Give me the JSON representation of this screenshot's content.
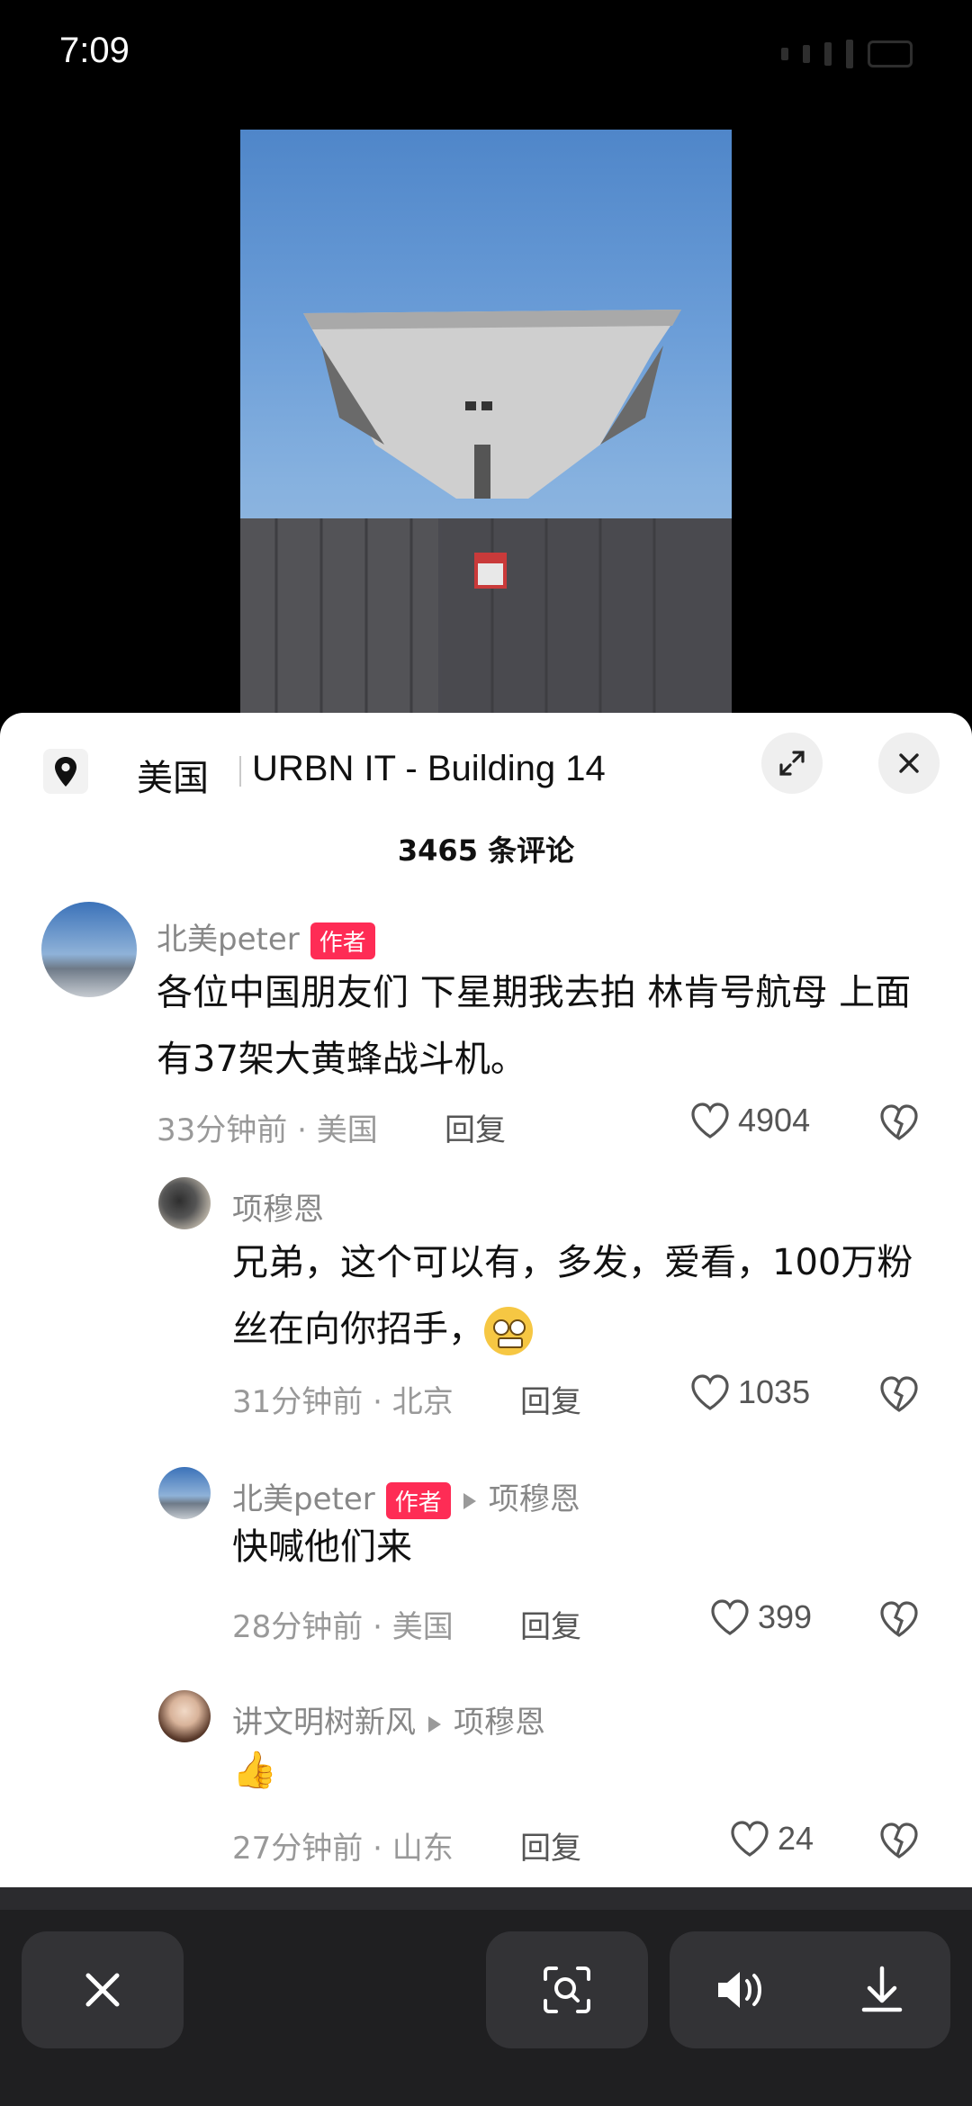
{
  "status_bar": {
    "time": "7:09"
  },
  "location": {
    "country": "美国",
    "place": "URBN IT - Building 14"
  },
  "comments_header": {
    "count_label": "3465 条评论"
  },
  "comments": [
    {
      "user": "北美peter",
      "badge": "作者",
      "text": "各位中国朋友们 下星期我去拍 林肯号航母 上面有37架大黄蜂战斗机。",
      "time": "33分钟前",
      "region": "美国",
      "reply_label": "回复",
      "likes": "4904"
    },
    {
      "user": "项穆恩",
      "text": "兄弟，这个可以有，多发，爱看，100万粉丝在向你招手，",
      "time": "31分钟前",
      "region": "北京",
      "reply_label": "回复",
      "likes": "1035"
    },
    {
      "user": "北美peter",
      "badge": "作者",
      "reply_to": "项穆恩",
      "text": "快喊他们来",
      "time": "28分钟前",
      "region": "美国",
      "reply_label": "回复",
      "likes": "399"
    },
    {
      "user": "讲文明树新风",
      "reply_to": "项穆恩",
      "text": "👍",
      "time": "27分钟前",
      "region": "山东",
      "reply_label": "回复",
      "likes": "24"
    }
  ],
  "colors": {
    "accent": "#fe2c55",
    "sheet_bg": "#ffffff",
    "toolbar_bg": "#1f1f21"
  },
  "icons": [
    "location-pin-icon",
    "expand-icon",
    "close-icon",
    "heart-icon",
    "dislike-heart-icon",
    "search-scan-icon",
    "speaker-icon",
    "download-icon"
  ]
}
